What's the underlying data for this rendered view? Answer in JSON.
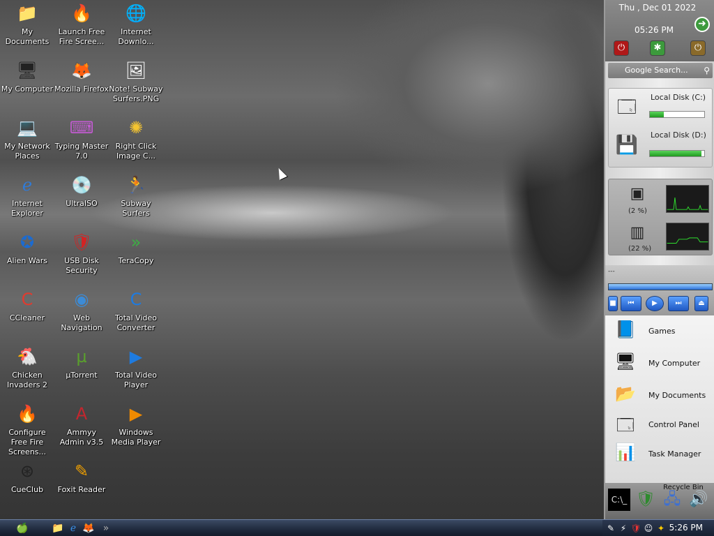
{
  "desktop": {
    "icons": [
      {
        "label": "My Documents",
        "glyph": "📁",
        "color": "#2f67c9"
      },
      {
        "label": "Launch Free Fire Scree...",
        "glyph": "🔥",
        "color": "#ff7a00"
      },
      {
        "label": "Internet Downlo...",
        "glyph": "🌐",
        "color": "#3aa53a"
      },
      {
        "label": "My Computer",
        "glyph": "🖥",
        "color": "#222222"
      },
      {
        "label": "Mozilla Firefox",
        "glyph": "🦊",
        "color": "#ff7a00"
      },
      {
        "label": "Note! Subway Surfers.PNG",
        "glyph": "🖼",
        "color": "#ffffff"
      },
      {
        "label": "My Network Places",
        "glyph": "💻",
        "color": "#333333"
      },
      {
        "label": "Typing Master 7.0",
        "glyph": "⌨",
        "color": "#c25bd1"
      },
      {
        "label": "Right Click Image C...",
        "glyph": "✺",
        "color": "#f4c430"
      },
      {
        "label": "Internet Explorer",
        "glyph": "ℯ",
        "color": "#2f7bd9"
      },
      {
        "label": "UltraISO",
        "glyph": "💿",
        "color": "#c0c0c0"
      },
      {
        "label": "Subway Surfers",
        "glyph": "🏃",
        "color": "#2d9b3a"
      },
      {
        "label": "Alien Wars",
        "glyph": "✪",
        "color": "#1c6bd0"
      },
      {
        "label": "USB Disk Security",
        "glyph": "🛡",
        "color": "#d32323"
      },
      {
        "label": "TeraCopy",
        "glyph": "»",
        "color": "#3cb043"
      },
      {
        "label": "CCleaner",
        "glyph": "C",
        "color": "#e03b2f"
      },
      {
        "label": "Web Navigation",
        "glyph": "◉",
        "color": "#3c8bd6"
      },
      {
        "label": "Total Video Converter",
        "glyph": "C",
        "color": "#1e7be0"
      },
      {
        "label": "Chicken Invaders 2",
        "glyph": "🐔",
        "color": "#d41f1f"
      },
      {
        "label": "µTorrent",
        "glyph": "µ",
        "color": "#5aa02c"
      },
      {
        "label": "Total Video Player",
        "glyph": "▶",
        "color": "#1e7be0"
      },
      {
        "label": "Configure Free Fire Screens...",
        "glyph": "🔥",
        "color": "#ff7a00"
      },
      {
        "label": "Ammyy Admin v3.5",
        "glyph": "A",
        "color": "#c4262e"
      },
      {
        "label": "Windows Media Player",
        "glyph": "▶",
        "color": "#f08a00"
      },
      {
        "label": "CueClub",
        "glyph": "⊛",
        "color": "#222222"
      },
      {
        "label": "Foxit Reader",
        "glyph": "✎",
        "color": "#f0a000"
      }
    ]
  },
  "sidebar": {
    "date": "Thu , Dec 01 2022",
    "time": "05:26 PM",
    "search_placeholder": "Google Search...",
    "disks": [
      {
        "label": "Local Disk (C:)",
        "used_pct": 25
      },
      {
        "label": "Local Disk (D:)",
        "used_pct": 95
      }
    ],
    "cpu": {
      "label": "(2 %)",
      "icon": "cpu-icon"
    },
    "mem": {
      "label": "(22 %)",
      "icon": "memory-icon"
    },
    "player_title": "---",
    "menu": [
      {
        "label": "Games",
        "glyph": "📘"
      },
      {
        "label": "My Computer",
        "glyph": "🖥"
      },
      {
        "label": "My Documents",
        "glyph": "📂"
      },
      {
        "label": "Control Panel",
        "glyph": "🗔"
      },
      {
        "label": "Task Manager",
        "glyph": "📊"
      }
    ],
    "dock_label": "Recycle Bin"
  },
  "taskbar": {
    "start_glyph": "",
    "clock": "5:26 PM",
    "quick_launch": [
      "folder",
      "ie",
      "firefox"
    ],
    "overflow": "»"
  },
  "colors": {
    "taskbar": "#1f2a3d",
    "sidebar": "#dcdcdc",
    "disk_fill": "#1f9a1f"
  }
}
